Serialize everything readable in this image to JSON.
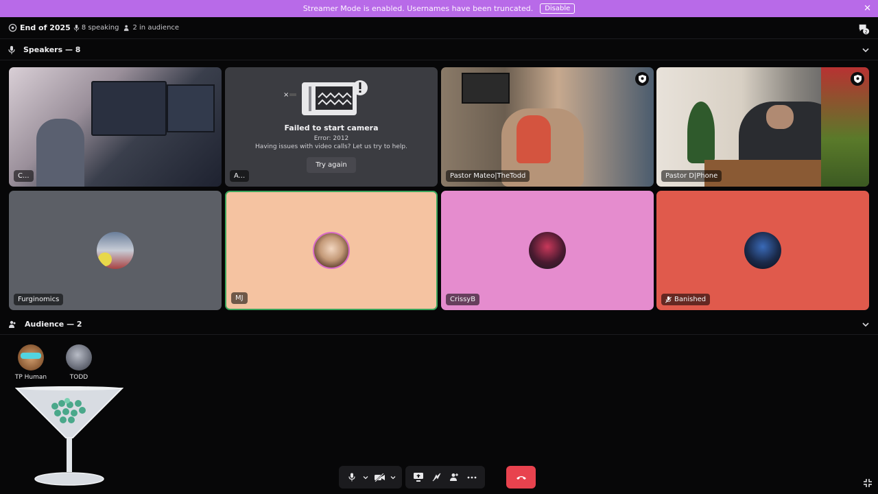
{
  "banner": {
    "text": "Streamer Mode is enabled. Usernames have been truncated.",
    "button": "Disable"
  },
  "stage": {
    "title": "End of 2025",
    "speaking": "8 speaking",
    "audience": "2 in audience"
  },
  "speakers_header": "Speakers — 8",
  "audience_header": "Audience — 2",
  "tiles": [
    {
      "name": "C..."
    },
    {
      "name": "A...",
      "error_title": "Failed to start camera",
      "error_code": "Error: 2012",
      "error_help": "Having issues with video calls? Let us try to help.",
      "retry": "Try again"
    },
    {
      "name": "Pastor Mateo|TheTodd"
    },
    {
      "name": "Pastor D|Phone"
    },
    {
      "name": "Furginomics"
    },
    {
      "name": "MJ"
    },
    {
      "name": "CrissyB"
    },
    {
      "name": "Banished"
    }
  ],
  "audience": [
    {
      "name": "TP Human"
    },
    {
      "name": "TODD"
    }
  ],
  "colors": {
    "banner": "#b86ae8",
    "leave": "#e8424e",
    "tile_gray": "#5c5f66",
    "tile_peach": "#f5c3a1",
    "tile_pink": "#e58cce",
    "tile_red": "#e05a4c",
    "speaking_ring": "#3ba55c"
  },
  "icons": [
    "stage-icon",
    "mic-icon",
    "audience-icon",
    "chat-icon",
    "shield-icon",
    "mic-muted-icon",
    "camera-off-icon",
    "screen-share-icon",
    "activity-icon",
    "invite-icon",
    "more-icon",
    "hang-up-icon",
    "minimize-icon"
  ]
}
